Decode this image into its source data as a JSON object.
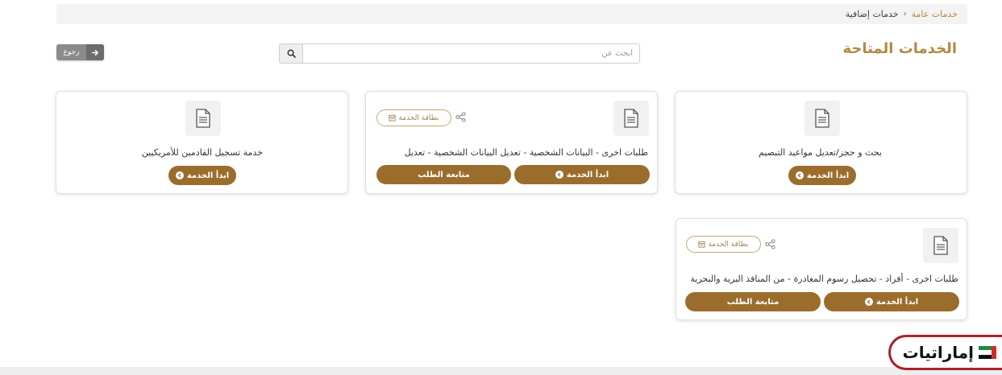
{
  "breadcrumb": {
    "parent": "خدمات عامة",
    "separator": "›",
    "current": "خدمات إضافية"
  },
  "page_title": "الخدمات المتاحة",
  "search": {
    "placeholder": "ابحث عن",
    "value": "",
    "icon": "search-icon"
  },
  "back_button": {
    "label": "رجوع",
    "icon": "arrow-right-icon"
  },
  "cards": [
    {
      "title": "بحث و حجز/تعديل مواعيد التبصيم",
      "icon": "document-icon",
      "start_label": "ابدأ الخدمة"
    },
    {
      "title": "طلبات اخرى - البيانات الشخصية - تعديل البيانات الشخصية - تعديل",
      "icon": "document-icon",
      "start_label": "ابدأ الخدمة",
      "track_label": "متابعة الطلب",
      "chip_label": "بطاقة الخدمة",
      "share_icon": "share-icon"
    },
    {
      "title": "خدمة تسجيل القادمين للأمريكيين",
      "icon": "document-icon",
      "start_label": "ابدأ الخدمة"
    },
    {
      "title": "طلبات اخرى - أفراد - تحصيل رسوم المغادرة - من المنافذ البرية والبحرية",
      "icon": "document-icon",
      "start_label": "ابدأ الخدمة",
      "track_label": "متابعة الطلب",
      "chip_label": "بطاقة الخدمة",
      "share_icon": "share-icon"
    }
  ],
  "logo": {
    "text": "إماراتيات"
  },
  "colors": {
    "accent": "#b08a45",
    "button": "#9b6d2c",
    "chip_border": "#c4a676",
    "logo_border": "#a8232a"
  }
}
